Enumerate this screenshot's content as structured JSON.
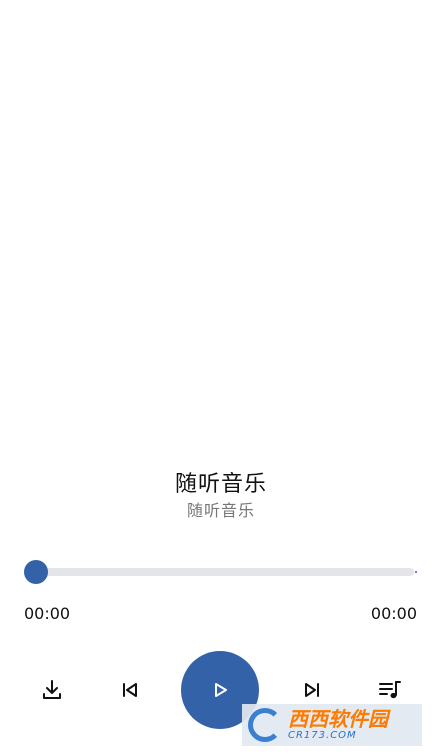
{
  "player": {
    "title": "随听音乐",
    "artist": "随听音乐",
    "progress_fraction": 0,
    "time_current": "00:00",
    "time_total": "00:00"
  },
  "controls": {
    "download_icon": "download-icon",
    "previous_icon": "skip-previous-icon",
    "play_icon": "play-icon",
    "next_icon": "skip-next-icon",
    "playlist_icon": "playlist-music-icon"
  },
  "colors": {
    "accent": "#3462a8",
    "track": "#e3e5e8",
    "text": "#111111",
    "subtext": "#777777"
  },
  "watermark": {
    "main": "西西软件园",
    "sub": "CR173.COM"
  }
}
